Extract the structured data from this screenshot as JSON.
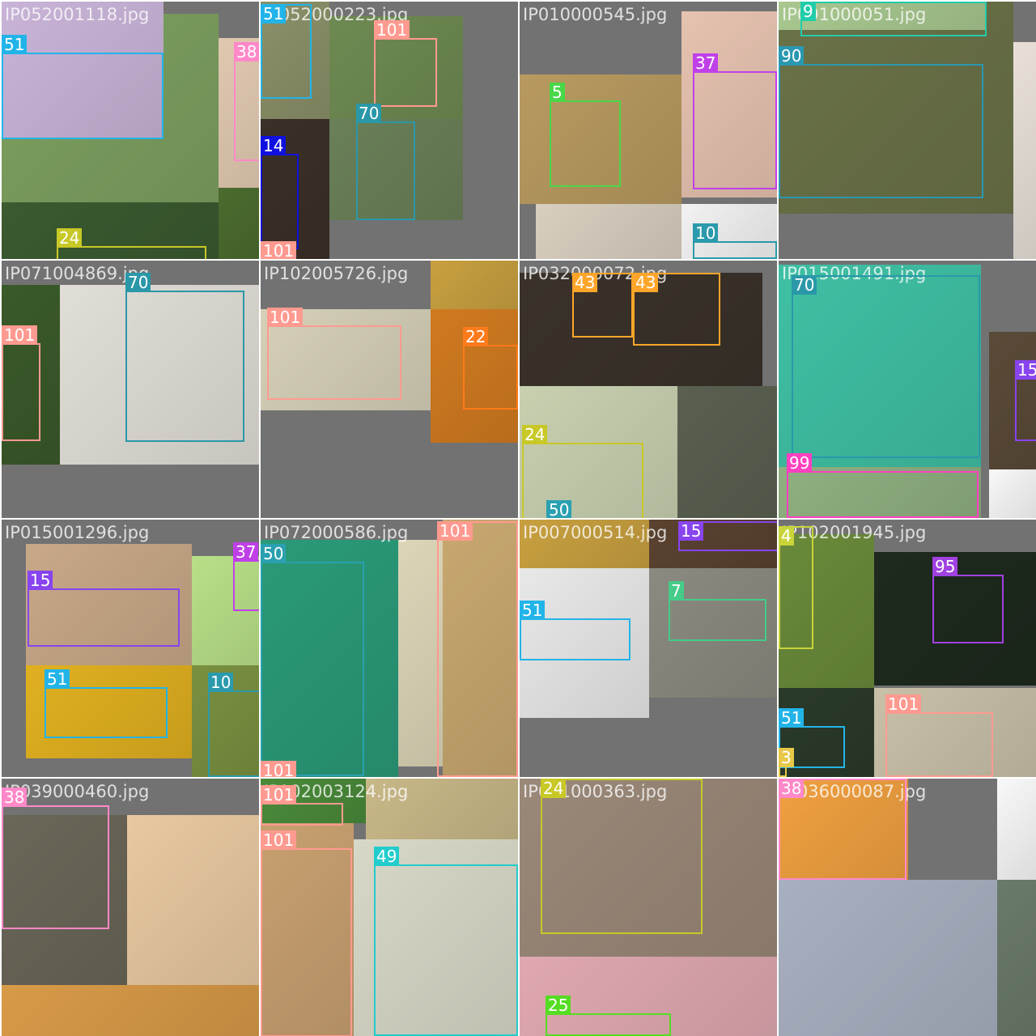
{
  "grid": {
    "rows": 4,
    "cols": 4,
    "background": "#727272"
  },
  "class_colors": {
    "3": "#e8c84a",
    "4": "#c8d43a",
    "5": "#48d848",
    "7": "#44cc88",
    "9": "#22ccaa",
    "10": "#2a9aac",
    "14": "#1010e0",
    "15": "#8844ee",
    "22": "#ff7a1a",
    "24": "#c8c826",
    "25": "#55dd22",
    "37": "#c040e8",
    "38": "#ff88c8",
    "43": "#ffa52a",
    "49": "#22cccc",
    "50": "#2aa0b0",
    "51": "#22b4e8",
    "70": "#2a98a8",
    "90": "#2a98b0",
    "95": "#a040e0",
    "99": "#ff40c0",
    "101": "#ff9a90"
  },
  "tiles": [
    {
      "filename": "IP052001118.jpg",
      "photos": [
        {
          "c": "#7da060"
        },
        {
          "c": "#c9b4d8"
        },
        {
          "c": "#3a5a30"
        },
        {
          "c": "#e0c8b0"
        },
        {
          "c": "#4b6b2e"
        }
      ],
      "boxes": [
        {
          "cls": "51"
        },
        {
          "cls": "38"
        },
        {
          "cls": "24"
        }
      ]
    },
    {
      "filename": "IP052000223.jpg",
      "photos": [
        {
          "c": "#8a9068"
        },
        {
          "c": "#6e8a52"
        },
        {
          "c": "#3b3028"
        },
        {
          "c": "#6a8058"
        }
      ],
      "boxes": [
        {
          "cls": "51"
        },
        {
          "cls": "101"
        },
        {
          "cls": "14"
        },
        {
          "cls": "70"
        },
        {
          "cls": "101"
        }
      ]
    },
    {
      "filename": "IP010000545.jpg",
      "photos": [
        {
          "c": "#b89a60"
        },
        {
          "c": "#e6c2b0"
        },
        {
          "c": "#d8cfc0"
        },
        {
          "c": "#f2f2f2"
        }
      ],
      "boxes": [
        {
          "cls": "5"
        },
        {
          "cls": "37"
        },
        {
          "cls": "10"
        }
      ]
    },
    {
      "filename": "IP091000051.jpg",
      "photos": [
        {
          "c": "#6a7248"
        },
        {
          "c": "#a8c890"
        },
        {
          "c": "#e8e0d8"
        }
      ],
      "boxes": [
        {
          "cls": "9"
        },
        {
          "cls": "90"
        }
      ]
    },
    {
      "filename": "IP071004869.jpg",
      "photos": [
        {
          "c": "#3a5a2a"
        },
        {
          "c": "#e0ded6"
        }
      ],
      "boxes": [
        {
          "cls": "70"
        },
        {
          "cls": "101"
        }
      ]
    },
    {
      "filename": "IP102005726.jpg",
      "photos": [
        {
          "c": "#d6d0b8"
        },
        {
          "c": "#c8a040"
        },
        {
          "c": "#d07a20"
        }
      ],
      "boxes": [
        {
          "cls": "101"
        },
        {
          "cls": "22"
        }
      ]
    },
    {
      "filename": "IP032000072.jpg",
      "photos": [
        {
          "c": "#3a322a"
        },
        {
          "c": "#c8d0b0"
        },
        {
          "c": "#5a6050"
        }
      ],
      "boxes": [
        {
          "cls": "43"
        },
        {
          "cls": "43"
        },
        {
          "cls": "24"
        },
        {
          "cls": "50"
        }
      ]
    },
    {
      "filename": "IP015001491.jpg",
      "photos": [
        {
          "c": "#3fc0a4"
        },
        {
          "c": "#5a4a38"
        },
        {
          "c": "#8fb080"
        },
        {
          "c": "#f8f8f8"
        }
      ],
      "boxes": [
        {
          "cls": "70"
        },
        {
          "cls": "15"
        },
        {
          "cls": "99"
        }
      ]
    },
    {
      "filename": "IP015001296.jpg",
      "photos": [
        {
          "c": "#c8a888"
        },
        {
          "c": "#b8e088"
        },
        {
          "c": "#e0b020"
        },
        {
          "c": "#7a9040"
        }
      ],
      "boxes": [
        {
          "cls": "15"
        },
        {
          "cls": "37"
        },
        {
          "cls": "51"
        },
        {
          "cls": "10"
        }
      ]
    },
    {
      "filename": "IP072000586.jpg",
      "photos": [
        {
          "c": "#2a9a78"
        },
        {
          "c": "#dcd6b8"
        },
        {
          "c": "#c8a870"
        }
      ],
      "boxes": [
        {
          "cls": "50"
        },
        {
          "cls": "101"
        },
        {
          "cls": "101"
        }
      ]
    },
    {
      "filename": "IP007000514.jpg",
      "photos": [
        {
          "c": "#c8a040"
        },
        {
          "c": "#5a4230"
        },
        {
          "c": "#e8e8e8"
        },
        {
          "c": "#8a8a80"
        }
      ],
      "boxes": [
        {
          "cls": "15"
        },
        {
          "cls": "51"
        },
        {
          "cls": "7"
        }
      ]
    },
    {
      "filename": "IP102001945.jpg",
      "photos": [
        {
          "c": "#6a8a3a"
        },
        {
          "c": "#1e2a1e"
        },
        {
          "c": "#2a3a2a"
        },
        {
          "c": "#c8c0a8"
        },
        {
          "c": "#f0d8a8"
        }
      ],
      "boxes": [
        {
          "cls": "4"
        },
        {
          "cls": "95"
        },
        {
          "cls": "51"
        },
        {
          "cls": "3"
        },
        {
          "cls": "101"
        }
      ]
    },
    {
      "filename": "IP039000460.jpg",
      "photos": [
        {
          "c": "#6a6658"
        },
        {
          "c": "#e8c8a0"
        },
        {
          "c": "#d89a48"
        }
      ],
      "boxes": [
        {
          "cls": "38"
        }
      ]
    },
    {
      "filename": "IP102003124.jpg",
      "photos": [
        {
          "c": "#4a8a3a"
        },
        {
          "c": "#c8b888"
        },
        {
          "c": "#c8a070"
        },
        {
          "c": "#d8d8c8"
        }
      ],
      "boxes": [
        {
          "cls": "101"
        },
        {
          "cls": "101"
        },
        {
          "cls": "49"
        }
      ]
    },
    {
      "filename": "IP021000363.jpg",
      "photos": [
        {
          "c": "#9a8878"
        },
        {
          "c": "#e0a8b0"
        }
      ],
      "boxes": [
        {
          "cls": "24"
        },
        {
          "cls": "25"
        }
      ]
    },
    {
      "filename": "IP036000087.jpg",
      "photos": [
        {
          "c": "#f0a040"
        },
        {
          "c": "#f8f8f8"
        },
        {
          "c": "#a8b0c0"
        },
        {
          "c": "#6a7a6a"
        }
      ],
      "boxes": [
        {
          "cls": "38"
        }
      ]
    }
  ]
}
